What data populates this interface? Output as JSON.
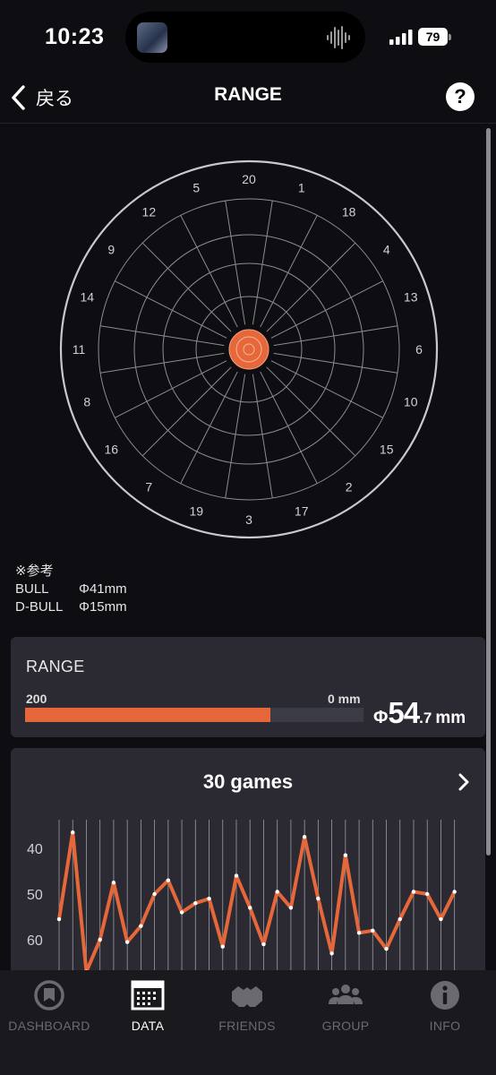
{
  "status_bar": {
    "time": "10:23",
    "battery": "79"
  },
  "nav": {
    "back_label": "戻る",
    "title": "RANGE",
    "help_label": "?"
  },
  "dartboard": {
    "numbers": [
      "20",
      "1",
      "18",
      "4",
      "13",
      "6",
      "10",
      "15",
      "2",
      "17",
      "3",
      "19",
      "7",
      "16",
      "8",
      "11",
      "14",
      "9",
      "12",
      "5"
    ],
    "bull_color": "#e5673a"
  },
  "reference": {
    "heading": "※参考",
    "rows": [
      {
        "label": "BULL",
        "value": "Φ41mm"
      },
      {
        "label": "D-BULL",
        "value": "Φ15mm"
      }
    ]
  },
  "range": {
    "title": "RANGE",
    "left_label": "200",
    "right_label": "0 mm",
    "value_prefix": "Φ",
    "value_int": "54",
    "value_dec": ".7",
    "value_unit": "mm",
    "fill_fraction": 0.726,
    "accent": "#e5673a"
  },
  "games": {
    "title": "30 games",
    "y_ticks": [
      "40",
      "50",
      "60"
    ],
    "line_color": "#e5673a"
  },
  "chart_data": {
    "type": "line",
    "title": "30 games",
    "y_ticks": [
      40,
      50,
      60
    ],
    "y_inverted": true,
    "grid": "vertical",
    "series": [
      {
        "values": [
          55.5,
          36.5,
          67,
          60,
          47.5,
          60.5,
          57,
          50,
          47,
          54,
          52,
          51,
          61.5,
          46,
          53,
          61,
          49.5,
          53,
          37.5,
          51,
          63,
          41.5,
          58.5,
          58,
          62,
          55.5,
          49.5,
          50,
          55.5,
          49.5
        ]
      }
    ]
  },
  "tabs": [
    {
      "label": "DASHBOARD",
      "icon": "dashboard-icon"
    },
    {
      "label": "DATA",
      "icon": "data-calendar-icon"
    },
    {
      "label": "FRIENDS",
      "icon": "friends-icon"
    },
    {
      "label": "GROUP",
      "icon": "group-icon"
    },
    {
      "label": "INFO",
      "icon": "info-icon"
    }
  ]
}
